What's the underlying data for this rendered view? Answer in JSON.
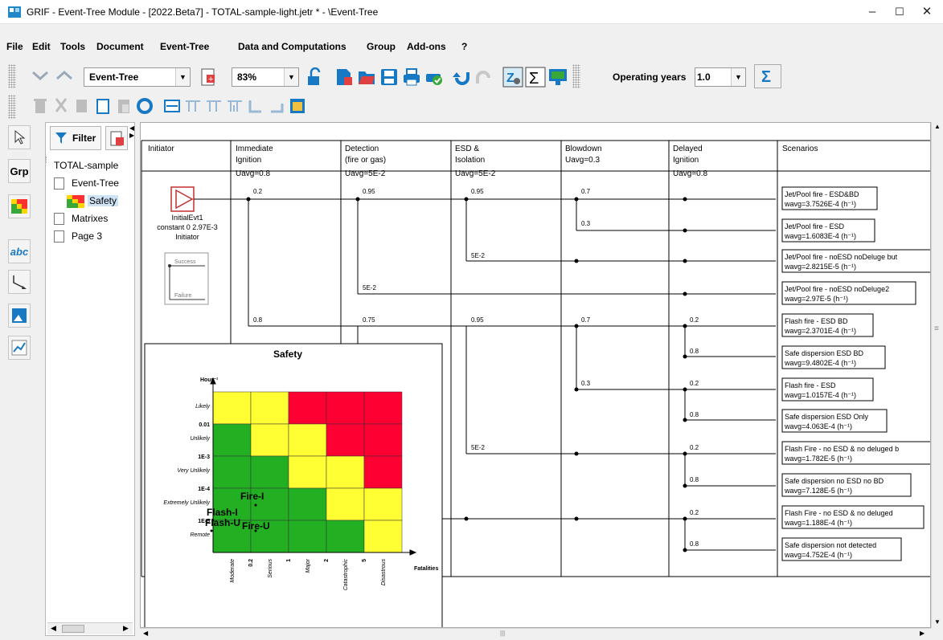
{
  "title": "GRIF - Event-Tree Module  - [2022.Beta7] - TOTAL-sample-light.jetr *  - \\Event-Tree",
  "window_buttons": {
    "minimize": "–",
    "maximize": "☐",
    "close": "✕"
  },
  "menu": [
    "File",
    "Edit",
    "Tools",
    "Document",
    "Event-Tree",
    "Data and Computations",
    "Group",
    "Add-ons",
    "?"
  ],
  "toolbar": {
    "module_combo": "Event-Tree",
    "zoom_combo": "83%",
    "operating_years_label": "Operating years",
    "operating_years_value": "1.0"
  },
  "sidebar_left": {
    "grp_label": "Grp",
    "abc_label": "abc"
  },
  "tree": {
    "filter_label": "Filter",
    "items": [
      "TOTAL-sample",
      "Event-Tree",
      "Safety",
      "Matrixes",
      "Page 3"
    ]
  },
  "event_tree": {
    "columns": [
      {
        "title1": "Initiator",
        "title2": "",
        "uavg": ""
      },
      {
        "title1": "Immediate",
        "title2": "Ignition",
        "uavg": "Uavg=0.8"
      },
      {
        "title1": "Detection",
        "title2": "(fire or gas)",
        "uavg": "Uavg=5E-2"
      },
      {
        "title1": "ESD &",
        "title2": "Isolation",
        "uavg": "Uavg=5E-2"
      },
      {
        "title1": "Blowdown",
        "title2": "",
        "uavg": "Uavg=0.3"
      },
      {
        "title1": "Delayed",
        "title2": "Ignition",
        "uavg": "Uavg=0.8"
      },
      {
        "title1": "Scenarios",
        "title2": "",
        "uavg": ""
      }
    ],
    "initiator": {
      "name": "InitialEvt1",
      "law": "constant 0 2.97E-3",
      "type": "Initiator"
    },
    "legend": {
      "success": "Success",
      "failure": "Failure"
    },
    "branch_labels": [
      "0.2",
      "0.95",
      "0.95",
      "0.7",
      "0.3",
      "5E-2",
      "5E-2",
      "0.8",
      "0.75",
      "0.95",
      "0.7",
      "0.2",
      "0.8",
      "0.3",
      "0.2",
      "0.8",
      "5E-2",
      "0.2",
      "0.8",
      "0.2",
      "0.8"
    ],
    "scenarios": [
      {
        "name": "Jet/Pool fire - ESD&BD",
        "value": "wavg=3.7526E-4 (h⁻¹)"
      },
      {
        "name": "Jet/Pool fire - ESD",
        "value": "wavg=1.6083E-4 (h⁻¹)"
      },
      {
        "name": "Jet/Pool fire - noESD noDeluge but",
        "value": "wavg=2.8215E-5 (h⁻¹)"
      },
      {
        "name": "Jet/Pool fire - noESD noDeluge2",
        "value": "wavg=2.97E-5 (h⁻¹)"
      },
      {
        "name": "Flash fire - ESD BD",
        "value": "wavg=2.3701E-4 (h⁻¹)"
      },
      {
        "name": "Safe dispersion ESD BD",
        "value": "wavg=9.4802E-4 (h⁻¹)"
      },
      {
        "name": "Flash fire - ESD",
        "value": "wavg=1.0157E-4 (h⁻¹)"
      },
      {
        "name": "Safe dispersion ESD Only",
        "value": "wavg=4.063E-4 (h⁻¹)"
      },
      {
        "name": "Flash Fire - no ESD & no deluged b",
        "value": "wavg=1.782E-5 (h⁻¹)"
      },
      {
        "name": "Safe dispersion no ESD no BD",
        "value": "wavg=7.128E-5 (h⁻¹)"
      },
      {
        "name": "Flash Fire - no ESD & no deluged",
        "value": "wavg=1.188E-4 (h⁻¹)"
      },
      {
        "name": "Safe dispersion not detected",
        "value": "wavg=4.752E-4 (h⁻¹)"
      }
    ]
  },
  "risk_matrix": {
    "title": "Safety",
    "y_axis_label": "Hour⁻¹",
    "x_axis_label": "Fatalities",
    "y_categories": [
      "Likely",
      "Unlikely",
      "Very Unlikely",
      "Extremely Unlikely",
      "Remote"
    ],
    "y_ticks": [
      "0.01",
      "1E-3",
      "1E-4",
      "1E-5"
    ],
    "x_categories": [
      "Moderate",
      "Serious",
      "Major",
      "Catastrophic",
      "Disastrous"
    ],
    "x_ticks": [
      "0.2",
      "1",
      "2",
      "5"
    ],
    "colors": {
      "green": "#22b022",
      "yellow": "#ffff33",
      "red": "#ff0033"
    },
    "grid": [
      [
        "yellow",
        "yellow",
        "red",
        "red",
        "red"
      ],
      [
        "green",
        "yellow",
        "yellow",
        "red",
        "red"
      ],
      [
        "green",
        "green",
        "yellow",
        "yellow",
        "red"
      ],
      [
        "green",
        "green",
        "green",
        "yellow",
        "yellow"
      ],
      [
        "green",
        "green",
        "green",
        "green",
        "yellow"
      ]
    ],
    "points": [
      {
        "label": "Fire-I"
      },
      {
        "label": "Flash-I"
      },
      {
        "label": "Flash-U"
      },
      {
        "label": "Fire-U"
      }
    ]
  }
}
